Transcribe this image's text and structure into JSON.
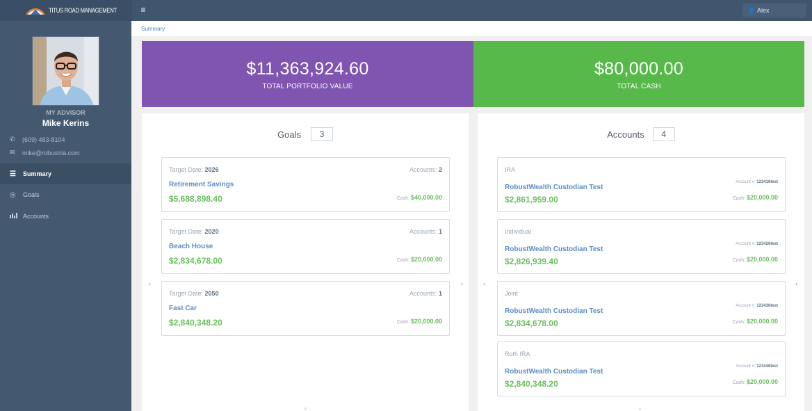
{
  "topbar": {
    "brand": "TITUS ROAD MANAGEMENT",
    "menu_icon": "hamburger-icon",
    "user": "Alex",
    "user_icon": "user-icon"
  },
  "sidebar": {
    "advisor_label": "MY ADVISOR",
    "advisor_name": "Mike Kerins",
    "phone": "(609) 483-8104",
    "email": "mike@robustria.com",
    "nav": [
      {
        "label": "Summary",
        "icon": "list-icon",
        "active": true
      },
      {
        "label": "Goals",
        "icon": "target-icon",
        "active": false
      },
      {
        "label": "Accounts",
        "icon": "bar-chart-icon",
        "active": false
      }
    ]
  },
  "breadcrumb": "Summary",
  "banners": {
    "portfolio": {
      "amount": "$11,363,924.60",
      "label": "TOTAL PORTFOLIO VALUE"
    },
    "cash": {
      "amount": "$80,000.00",
      "label": "TOTAL CASH"
    }
  },
  "goals": {
    "title": "Goals",
    "count": "3",
    "items": [
      {
        "target_label": "Target Date:",
        "target_date": "2026",
        "accounts_label": "Accounts:",
        "accounts": "2",
        "name": "Retirement Savings",
        "value": "$5,688,898.40",
        "cash_label": "Cash:",
        "cash": "$40,000.00"
      },
      {
        "target_label": "Target Date:",
        "target_date": "2020",
        "accounts_label": "Accounts:",
        "accounts": "1",
        "name": "Beach House",
        "value": "$2,834,678.00",
        "cash_label": "Cash:",
        "cash": "$20,000.00"
      },
      {
        "target_label": "Target Date:",
        "target_date": "2050",
        "accounts_label": "Accounts:",
        "accounts": "1",
        "name": "Fast Car",
        "value": "$2,840,348.20",
        "cash_label": "Cash:",
        "cash": "$20,000.00"
      }
    ]
  },
  "accounts": {
    "title": "Accounts",
    "count": "4",
    "items": [
      {
        "type": "IRA",
        "acct_label": "Account #:",
        "acct_num": "123416test",
        "name": "RobustWealth Custodian Test",
        "value": "$2,861,959.00",
        "cash_label": "Cash:",
        "cash": "$20,000.00"
      },
      {
        "type": "Individual",
        "acct_label": "Account #:",
        "acct_num": "123426test",
        "name": "RobustWealth Custodian Test",
        "value": "$2,826,939.40",
        "cash_label": "Cash:",
        "cash": "$20,000.00"
      },
      {
        "type": "Joint",
        "acct_label": "Account #:",
        "acct_num": "123436test",
        "name": "RobustWealth Custodian Test",
        "value": "$2,834,678.00",
        "cash_label": "Cash:",
        "cash": "$20,000.00"
      },
      {
        "type": "Roth IRA",
        "acct_label": "Account #:",
        "acct_num": "123446test",
        "name": "RobustWealth Custodian Test",
        "value": "$2,840,348.20",
        "cash_label": "Cash:",
        "cash": "$20,000.00"
      }
    ]
  },
  "colors": {
    "portfolio_banner": "#7f55b1",
    "cash_banner": "#57b94a",
    "sidebar": "#44586f",
    "link": "#5b8dc4",
    "money": "#6abf5e"
  }
}
